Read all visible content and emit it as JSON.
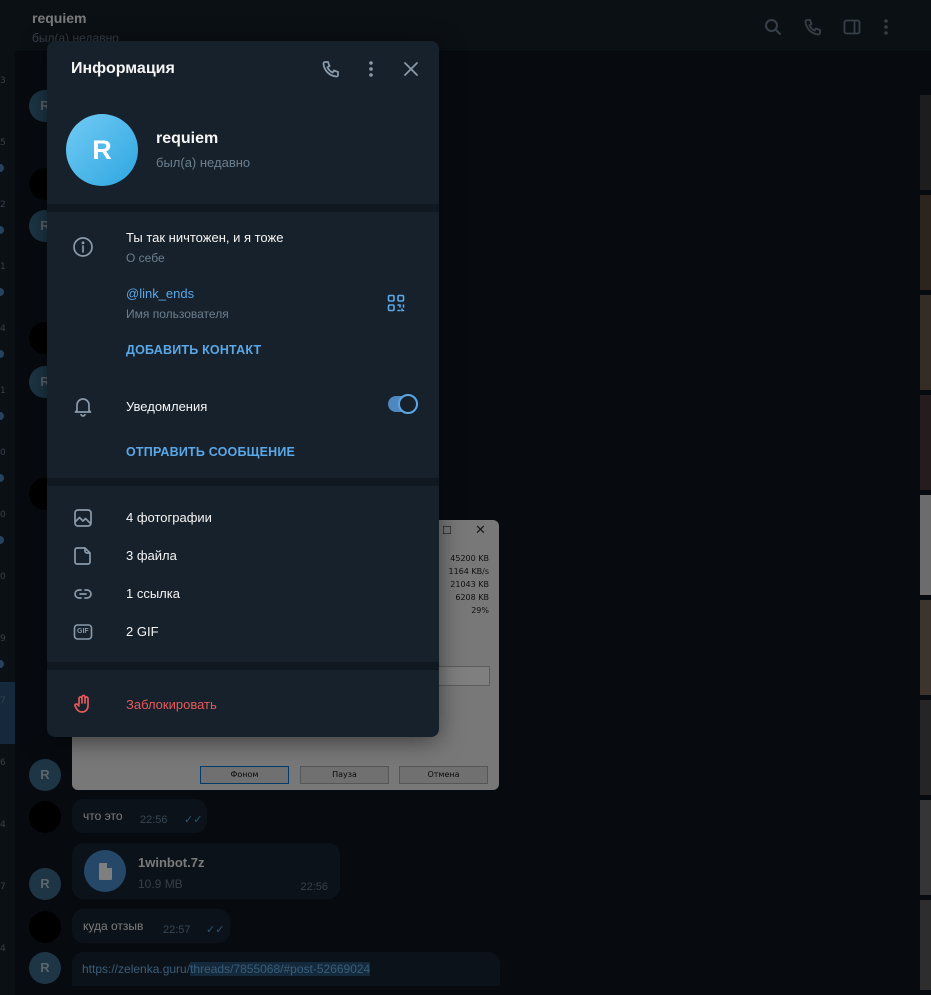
{
  "background": {
    "chat_title": "requiem",
    "chat_status": "был(а) недавно",
    "left_numbers": [
      "3",
      "5",
      "2",
      "1",
      "4",
      "1",
      "0",
      "0",
      "0",
      "9",
      "7",
      "6",
      "4",
      "7",
      "4"
    ],
    "avatar_letter": "R",
    "messages": [
      {
        "text": "что это",
        "time": "22:56",
        "ticks": "✓✓"
      },
      {
        "text": "куда отзыв",
        "time": "22:57",
        "ticks": "✓✓"
      }
    ],
    "file": {
      "name": "1winbot.7z",
      "size": "10.9 MB",
      "time": "22:56"
    },
    "link": {
      "part1": "https://zelenka.guru/",
      "part2": "threads/7855068/#post-52669024"
    },
    "screenshot_window": {
      "values": [
        "45200 KB",
        "1164 KB/s",
        "21043 KB",
        "6208 KB",
        "29%"
      ],
      "buttons": [
        "Фоном",
        "Пауза",
        "Отмена"
      ]
    }
  },
  "panel": {
    "title": "Информация",
    "avatar_letter": "R",
    "name": "requiem",
    "status": "был(а) недавно",
    "bio": "Ты так ничтожен, и я тоже",
    "bio_label": "О себе",
    "username": "@link_ends",
    "username_label": "Имя пользователя",
    "add_contact": "ДОБАВИТЬ КОНТАКТ",
    "notifications": "Уведомления",
    "notifications_on": true,
    "send_message": "ОТПРАВИТЬ СООБЩЕНИЕ",
    "media": {
      "photos": "4 фотографии",
      "files": "3 файла",
      "links": "1 ссылка",
      "gifs": "2 GIF"
    },
    "gif_badge": "GIF",
    "block": "Заблокировать"
  },
  "icons": {
    "header": [
      "phone-icon",
      "more-vertical-icon",
      "close-icon"
    ],
    "topbar": [
      "search-icon",
      "phone-icon",
      "sidebar-icon",
      "more-vertical-icon"
    ]
  },
  "colors": {
    "accent": "#5aa8e8",
    "danger": "#e55a5a",
    "panel_bg": "#17212b",
    "app_bg": "#0e1621"
  }
}
